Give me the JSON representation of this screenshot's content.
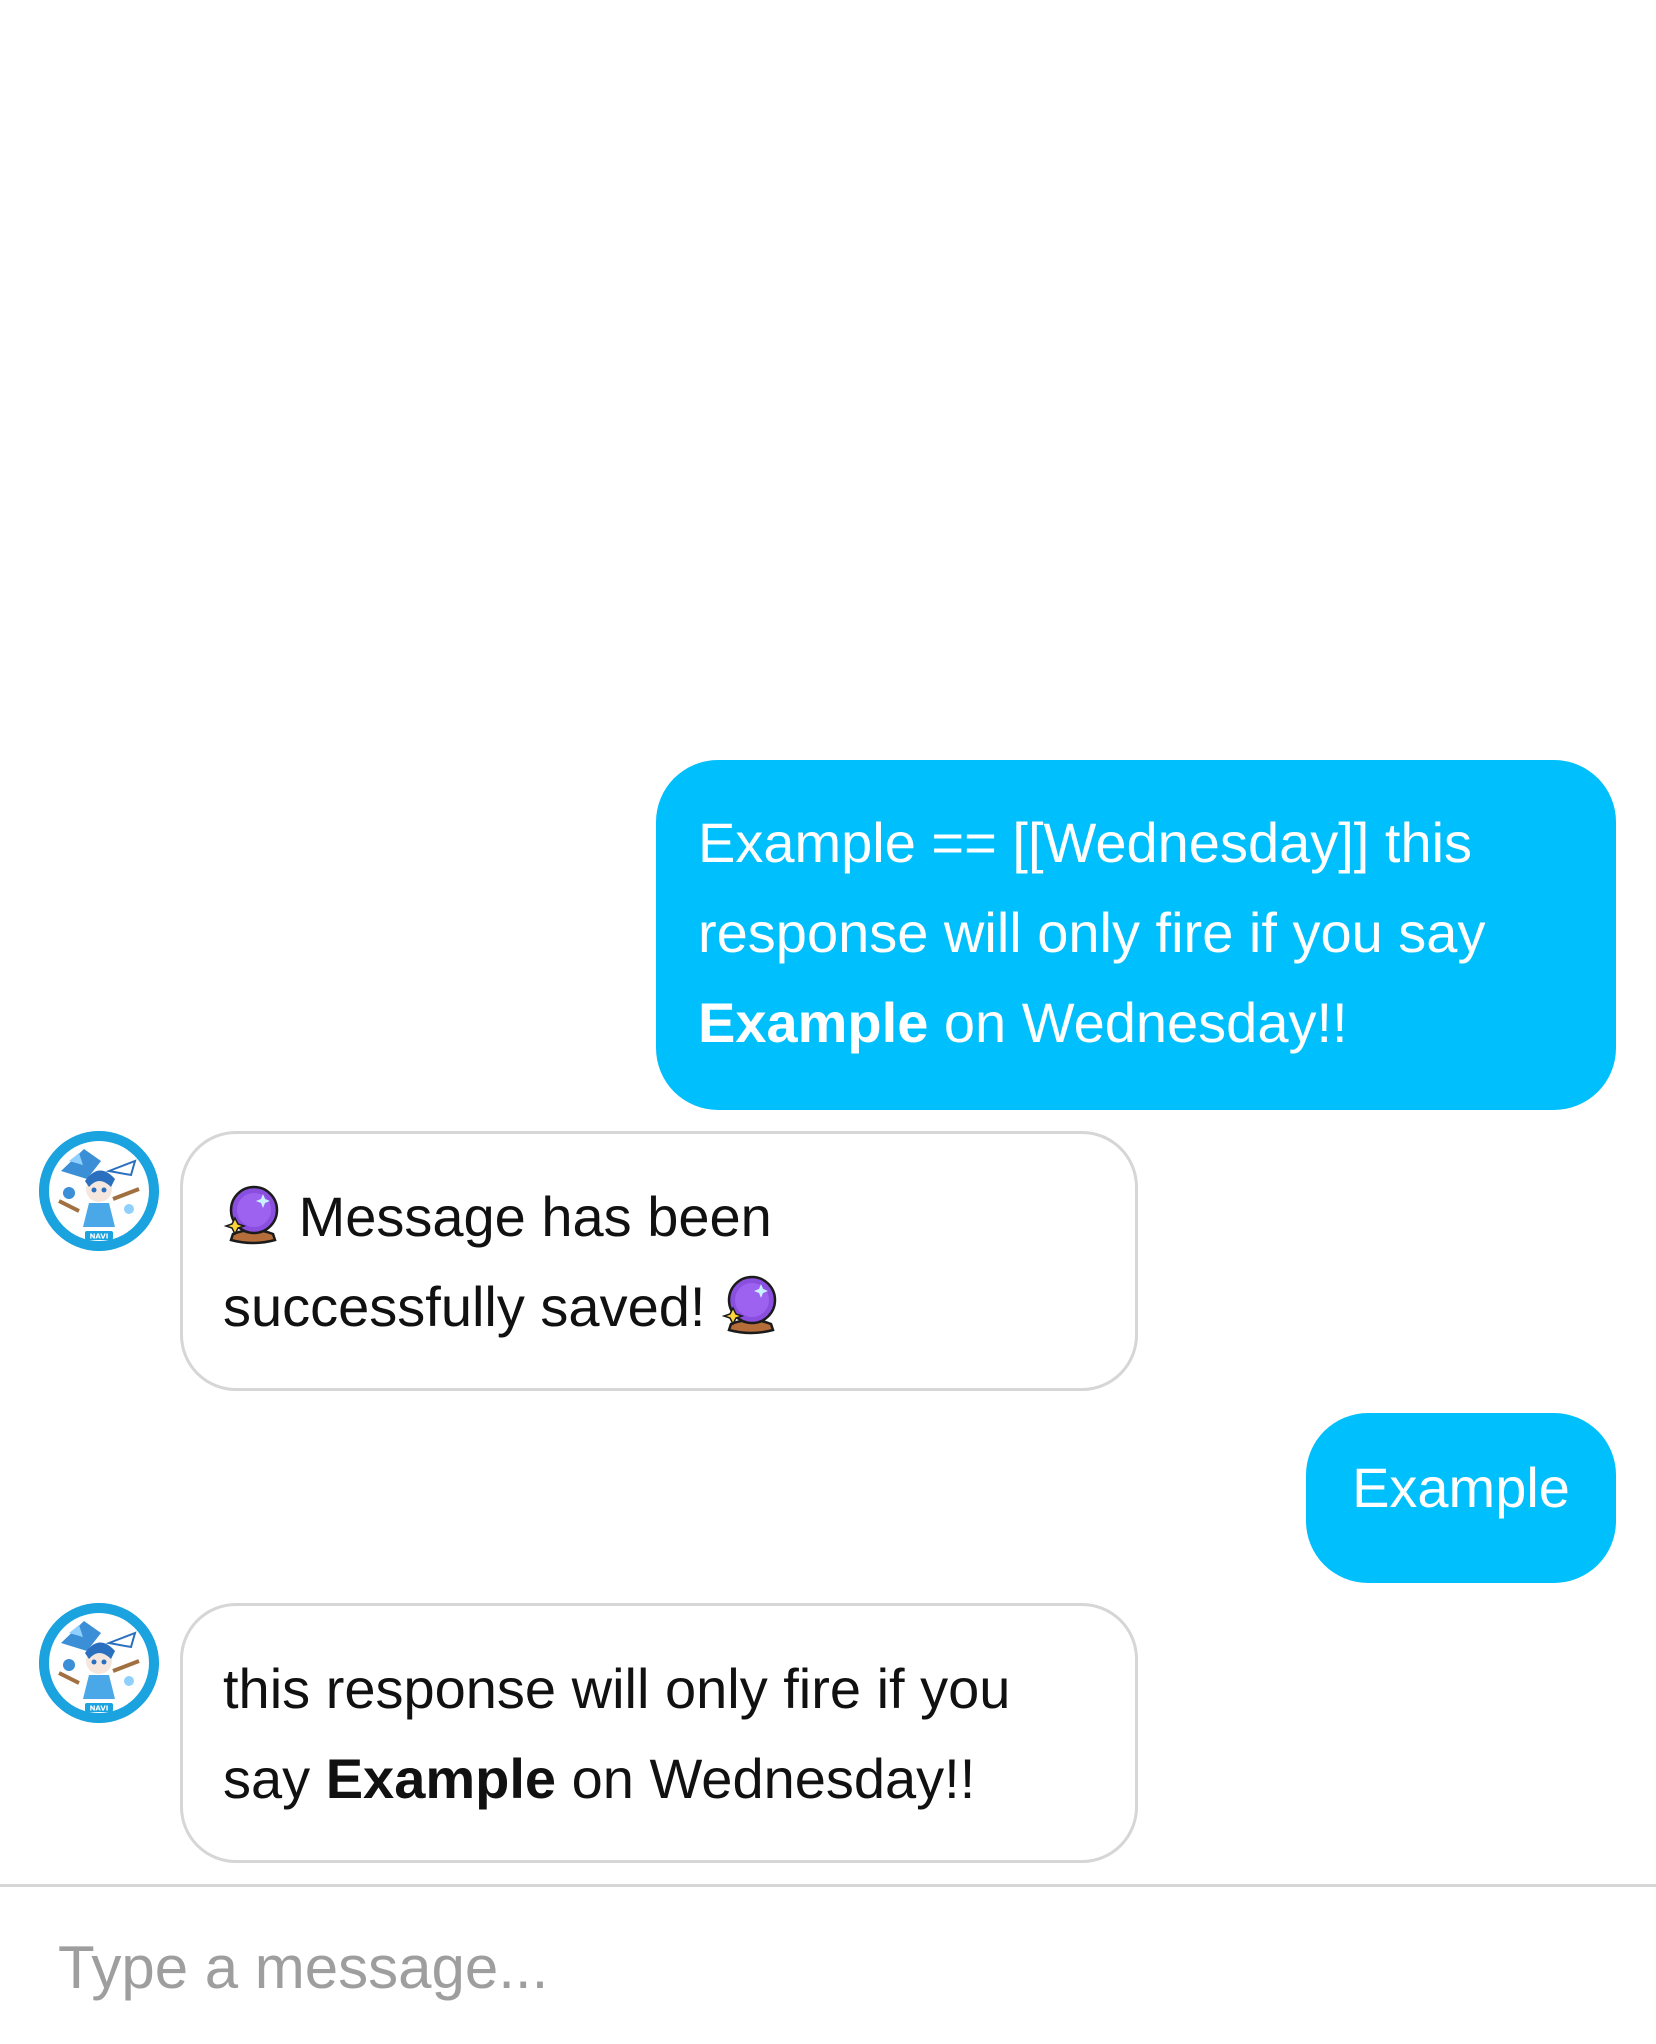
{
  "colors": {
    "outgoing_bubble": "#00bffd",
    "incoming_border": "#d6d6d6",
    "avatar_ring": "#1aa3df"
  },
  "messages": [
    {
      "direction": "outgoing",
      "lines": [
        {
          "text": "Example == [[Wednesday]] this"
        },
        {
          "text": "response will only fire if you say"
        },
        {
          "bold": "Example",
          "text": " on Wednesday!!"
        }
      ]
    },
    {
      "direction": "incoming",
      "avatar": {
        "name": "bot-avatar",
        "label": "NAVI"
      },
      "icon": "crystal-ball-icon",
      "lines": [
        {
          "text": "Message has been"
        },
        {
          "text": "successfully saved!"
        }
      ]
    },
    {
      "direction": "outgoing",
      "lines": [
        {
          "text": "Example"
        }
      ]
    },
    {
      "direction": "incoming",
      "avatar": {
        "name": "bot-avatar",
        "label": "NAVI"
      },
      "lines": [
        {
          "text": "this response will only fire if you"
        },
        {
          "pre": "say ",
          "bold": "Example",
          "text": " on Wednesday!!"
        }
      ]
    }
  ],
  "composer": {
    "placeholder": "Type a message...",
    "value": ""
  }
}
